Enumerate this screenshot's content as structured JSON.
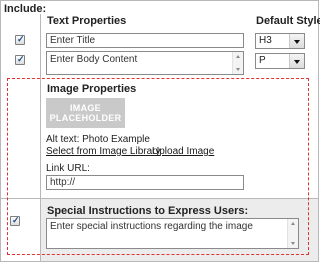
{
  "include_label": "Include:",
  "text_properties": {
    "header": "Text Properties",
    "default_style_header": "Default Style",
    "title_field": {
      "value": "Enter Title",
      "checked": true
    },
    "body_field": {
      "value": "Enter Body Content",
      "checked": true
    },
    "title_style": "H3",
    "body_style": "P"
  },
  "image_properties": {
    "header": "Image Properties",
    "placeholder_line1": "IMAGE",
    "placeholder_line2": "PLACEHOLDER",
    "alt_text": "Alt text: Photo Example",
    "select_link": "Select from Image Library",
    "upload_link": "Upload Image",
    "link_url_label": "Link URL:",
    "link_url_value": "http://"
  },
  "special_instructions": {
    "header": "Special Instructions to Express Users:",
    "value": "Enter special instructions regarding the image",
    "checked": true
  },
  "colors": {
    "dashed_border": "#e0332f",
    "checkmark": "#1d4c8a",
    "placeholder_bg": "#c9c9c9",
    "special_bg": "#ececec"
  }
}
